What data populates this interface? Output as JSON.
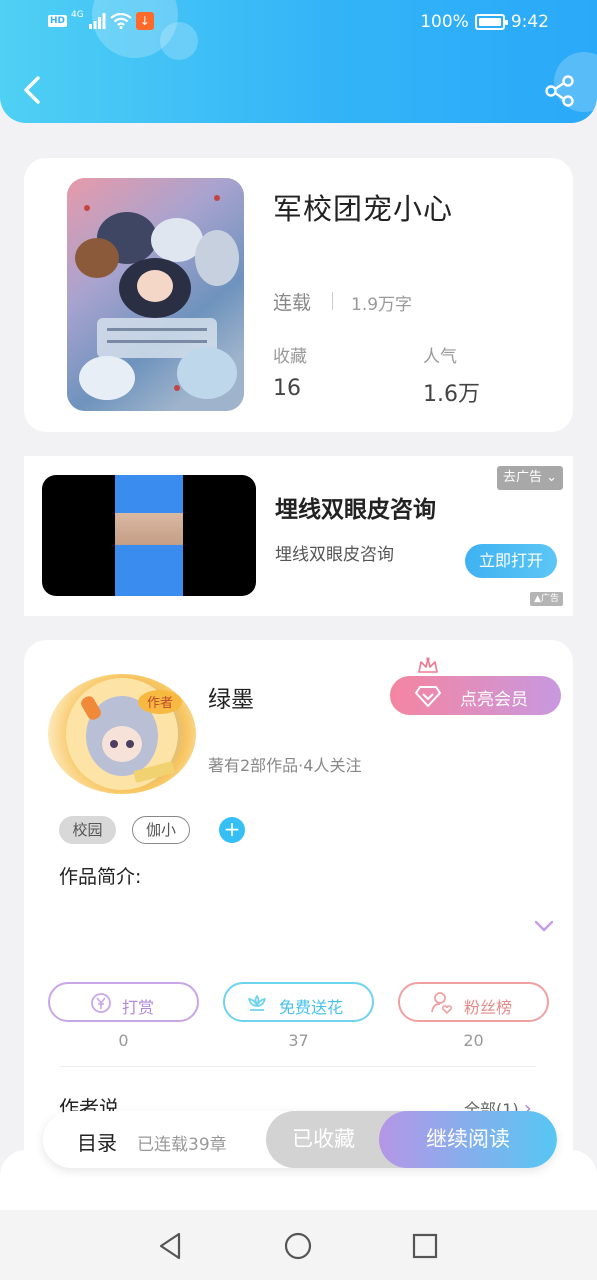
{
  "status_bar": {
    "network": "4G",
    "hd": "HD",
    "battery": "100%",
    "time": "9:42"
  },
  "header": {
    "back_icon": "chevron-left-icon",
    "share_icon": "share-icon"
  },
  "book": {
    "title": "军校团宠小心",
    "status": "连载",
    "word_count": "1.9万字",
    "favorites_label": "收藏",
    "favorites_value": "16",
    "popularity_label": "人气",
    "popularity_value": "1.6万"
  },
  "ad": {
    "title": "埋线双眼皮咨询",
    "subtitle": "埋线双眼皮咨询",
    "close_label": "去广告",
    "open_label": "立即打开",
    "ad_mark": "广告"
  },
  "author": {
    "name": "绿墨",
    "meta": "著有2部作品·4人关注",
    "vip_label": "点亮会员",
    "avatar_badge": "作者",
    "tags": [
      "校园",
      "伽小"
    ],
    "intro_label": "作品简介:",
    "actions": [
      {
        "label": "打赏",
        "count": "0",
        "icon": "yen-coin-icon"
      },
      {
        "label": "免费送花",
        "count": "37",
        "icon": "flower-icon"
      },
      {
        "label": "粉丝榜",
        "count": "20",
        "icon": "user-heart-icon"
      }
    ],
    "author_says_label": "作者说",
    "all_label": "全部(1)"
  },
  "bottom_bar": {
    "toc_label": "目录",
    "chapter_count": "已连载39章",
    "favorited_label": "已收藏",
    "continue_label": "继续阅读"
  },
  "colors": {
    "header_start": "#4fd0f4",
    "header_end": "#29a9f8",
    "vip_start": "#f585a0",
    "vip_end": "#c898e0",
    "read_start": "#b596e6",
    "read_end": "#56c7f3"
  }
}
